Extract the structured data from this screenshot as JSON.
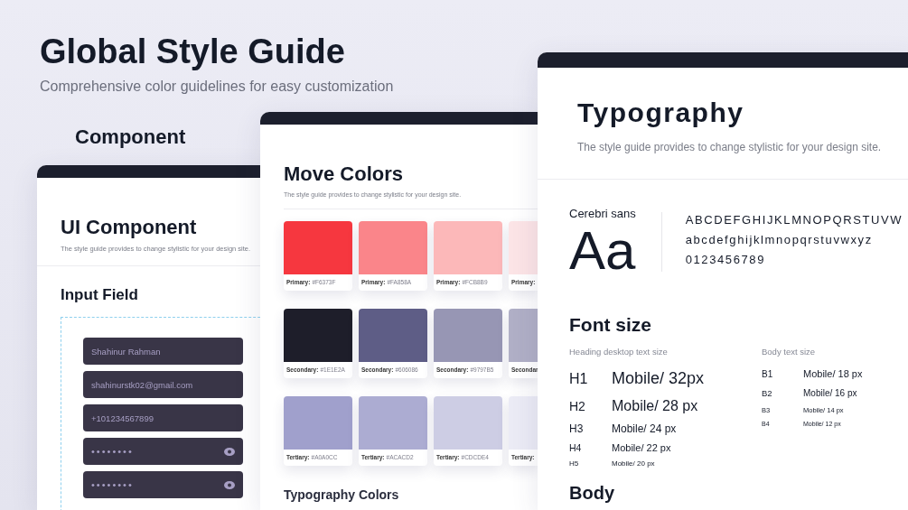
{
  "header": {
    "title": "Global Style Guide",
    "subtitle": "Comprehensive color guidelines for easy customization",
    "section_label": "Component"
  },
  "ui_component_card": {
    "title": "UI Component",
    "subtitle": "The style guide provides to change stylistic for your design site.",
    "section_title": "Input Field",
    "inputs": [
      {
        "kind": "text",
        "value": "Shahinur Rahman"
      },
      {
        "kind": "text",
        "value": "shahinurstk02@gmail.com"
      },
      {
        "kind": "text",
        "value": "+101234567899"
      },
      {
        "kind": "password",
        "value": "••••••••"
      },
      {
        "kind": "password",
        "value": "••••••••"
      }
    ]
  },
  "colors_card": {
    "title": "Move Colors",
    "subtitle": "The style guide provides to change stylistic for your design site.",
    "swatch_rows": [
      [
        {
          "label": "Primary:",
          "code": "#F6373F",
          "color": "#f6373f"
        },
        {
          "label": "Primary:",
          "code": "#FA858A",
          "color": "#fa858a"
        },
        {
          "label": "Primary:",
          "code": "#FCB8B9",
          "color": "#fcb8b9"
        },
        {
          "label": "Primary:",
          "color": "#fce4e6"
        }
      ],
      [
        {
          "label": "Secondary:",
          "code": "#1E1E2A",
          "color": "#1e1e2a"
        },
        {
          "label": "Secondary:",
          "code": "#606086",
          "color": "#5e5d86"
        },
        {
          "label": "Secondary:",
          "code": "#9797B5",
          "color": "#9796b4"
        },
        {
          "label": "Secondar",
          "color": "#b0afc6"
        }
      ],
      [
        {
          "label": "Tertiary:",
          "code": "#A0A0CC",
          "color": "#a0a0cc"
        },
        {
          "label": "Tertiary:",
          "code": "#ACACD2",
          "color": "#acacd2"
        },
        {
          "label": "Tertiary:",
          "code": "#CDCDE4",
          "color": "#cdcde4"
        },
        {
          "label": "Tertiary:",
          "color": "#ebebf5"
        }
      ]
    ],
    "typography_colors_title": "Typography Colors"
  },
  "typography_card": {
    "title": "Typography",
    "subtitle": "The style guide provides to change stylistic for your design site.",
    "font_name": "Cerebri sans",
    "specimen": "Aa",
    "glyph_lines": [
      "ABCDEFGHIJKLMNOPQRSTUVW",
      "abcdefghijklmnopqrstuvwxyz",
      "0123456789"
    ],
    "font_size": {
      "title": "Font size",
      "heading_label": "Heading desktop text size",
      "headings": [
        {
          "tag": "H1",
          "sample": "Mobile/ 32px"
        },
        {
          "tag": "H2",
          "sample": "Mobile/ 28 px"
        },
        {
          "tag": "H3",
          "sample": "Mobile/ 24 px"
        },
        {
          "tag": "H4",
          "sample": "Mobile/ 22 px"
        },
        {
          "tag": "H5",
          "sample": "Mobile/ 20 px"
        }
      ],
      "body_label": "Body text size",
      "body": [
        {
          "tag": "B1",
          "sample": "Mobile/ 18 px"
        },
        {
          "tag": "B2",
          "sample": "Mobile/ 16 px"
        },
        {
          "tag": "B3",
          "sample": "Mobile/ 14 px"
        },
        {
          "tag": "B4",
          "sample": "Mobile/ 12 px"
        }
      ]
    },
    "next_section_title": "Body"
  }
}
